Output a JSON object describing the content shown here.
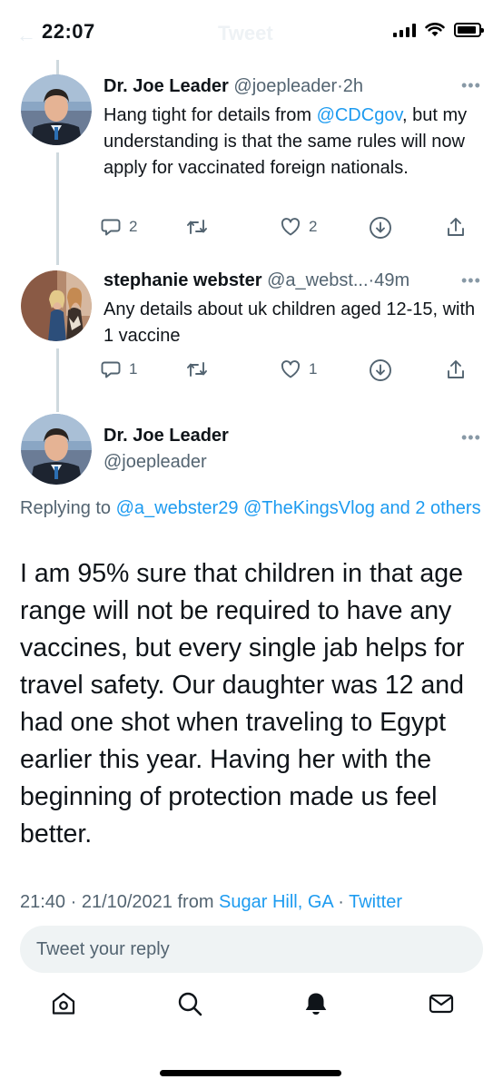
{
  "status_bar": {
    "time": "22:07",
    "nav_title": "Tweet"
  },
  "thread": [
    {
      "name": "Dr. Joe Leader",
      "handle": "@joepleader",
      "sep": "·",
      "time": "2h",
      "text_parts": [
        "Hang tight for details from ",
        "@CDCgov",
        ", but my understanding is that the same rules will now apply for vaccinated foreign nationals."
      ],
      "reply_count": "2",
      "like_count": "2"
    },
    {
      "name": "stephanie webster",
      "handle": "@a_webst...",
      "sep": "·",
      "time": "49m",
      "text": "Any details about uk children aged 12-15, with 1 vaccine",
      "reply_count": "1",
      "like_count": "1"
    }
  ],
  "main_tweet": {
    "name": "Dr. Joe Leader",
    "handle": "@joepleader",
    "replying_prefix": "Replying to ",
    "replying_to": "@a_webster29 @TheKingsVlog and 2 others",
    "text": "I am 95% sure that children in that age range will not be required to have any vaccines, but every single jab helps for travel safety.  Our daughter was 12 and had one shot when traveling to Egypt earlier this year. Having her with the beginning of protection made us feel better.",
    "time": "21:40 · 21/10/2021",
    "from_word": " from ",
    "location": "Sugar Hill, GA",
    "source_sep": " · ",
    "source": "Twitter"
  },
  "reply_box": {
    "placeholder": "Tweet your reply"
  },
  "tabs": [
    "home",
    "search",
    "notifications",
    "messages"
  ],
  "colors": {
    "accent": "#1d9bf0",
    "text": "#0f1419",
    "secondary": "#536471"
  }
}
